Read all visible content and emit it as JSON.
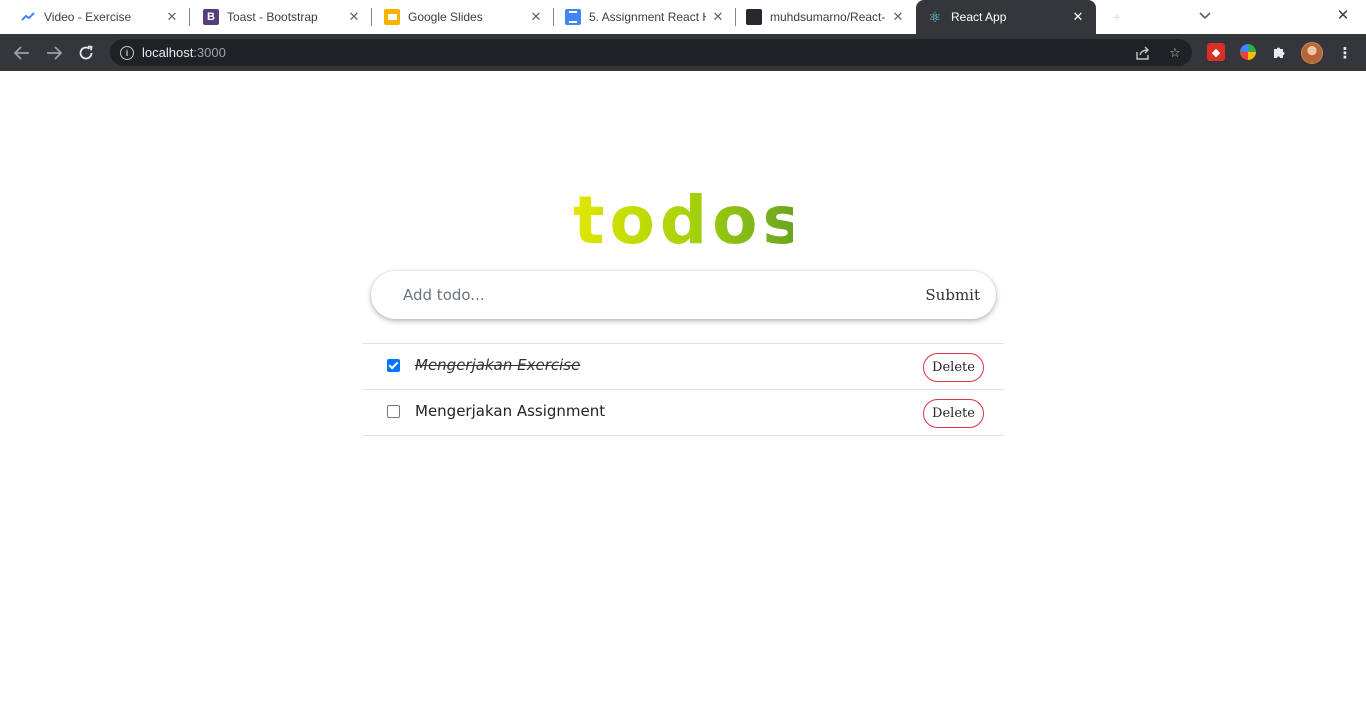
{
  "browser": {
    "tabs": [
      {
        "title": "Video - Exercise",
        "favicon": "analytics-icon"
      },
      {
        "title": "Toast - Bootstrap",
        "favicon": "bootstrap-icon"
      },
      {
        "title": "Google Slides",
        "favicon": "slides-icon"
      },
      {
        "title": "5. Assignment React H",
        "favicon": "docs-icon"
      },
      {
        "title": "muhdsumarno/React-H",
        "favicon": "github-icon"
      },
      {
        "title": "React App",
        "favicon": "react-icon",
        "active": true
      }
    ],
    "address": {
      "host": "localhost",
      "port": ":3000"
    }
  },
  "app": {
    "logo": "todos",
    "logo_gradient": [
      "#e1e700",
      "#a4d10c",
      "#6aa520"
    ],
    "input_placeholder": "Add todo...",
    "input_value": "",
    "submit_label": "Submit",
    "todos": [
      {
        "text": "Mengerjakan Exercise",
        "completed": true,
        "delete_label": "Delete"
      },
      {
        "text": "Mengerjakan Assignment",
        "completed": false,
        "delete_label": "Delete"
      }
    ],
    "delete_border_color": "#dc3545",
    "checkbox_color": "#0075ff"
  }
}
